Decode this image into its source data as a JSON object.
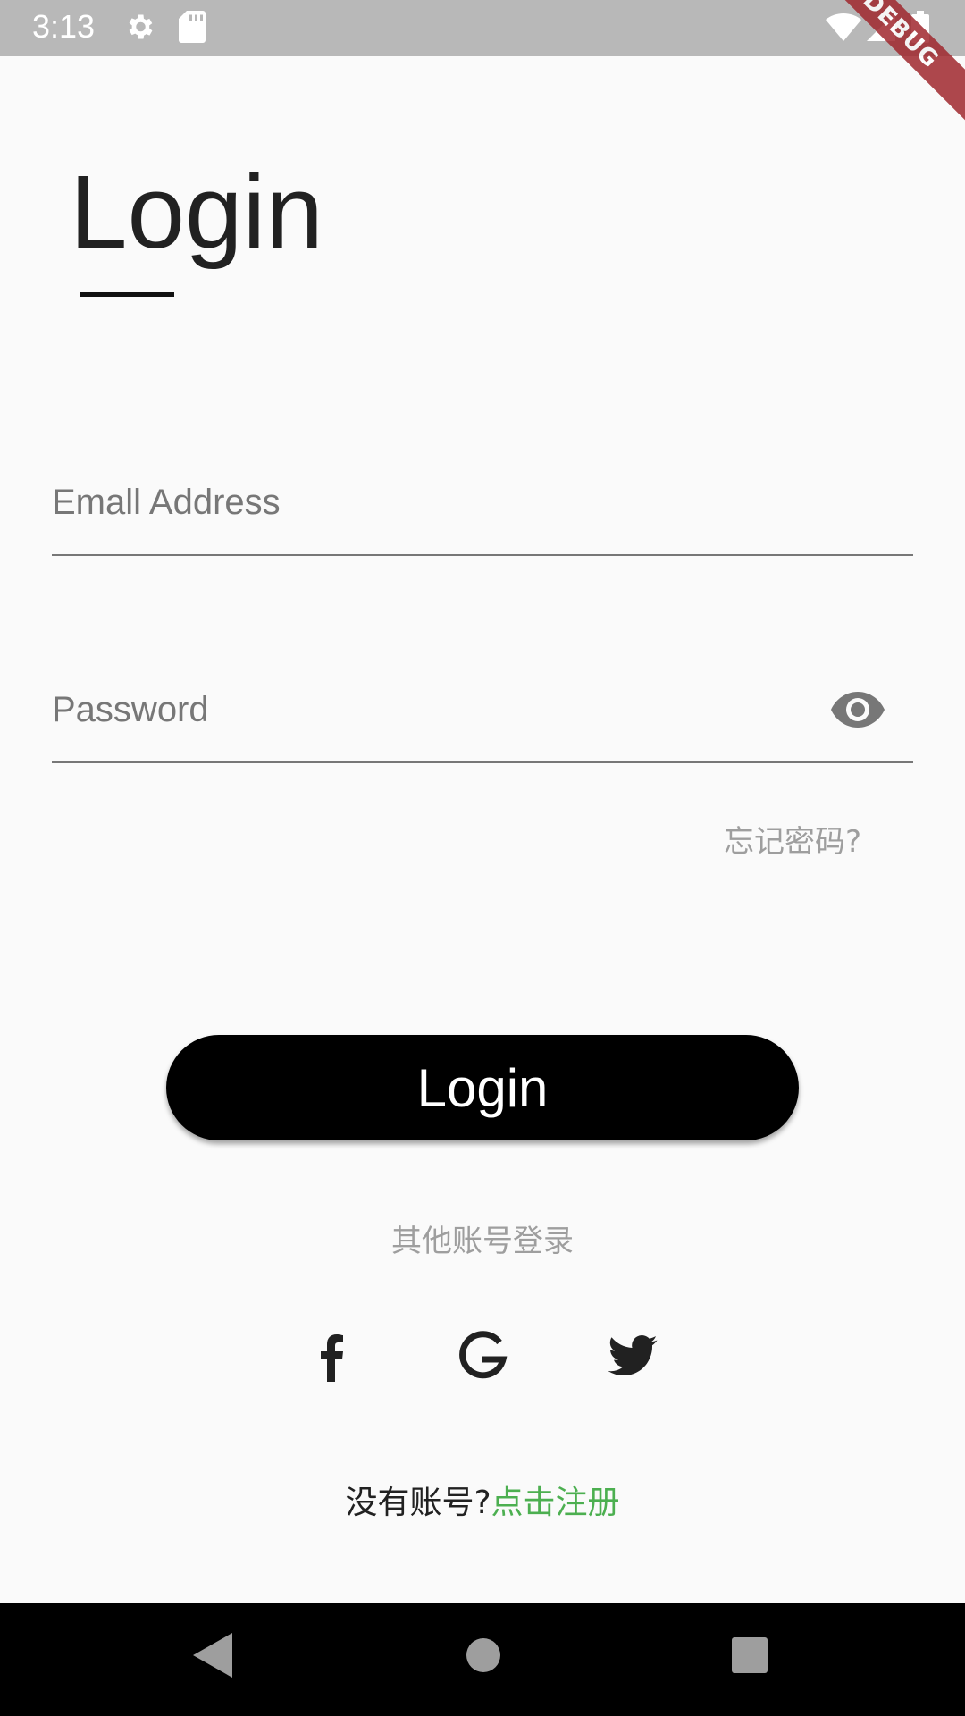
{
  "status_bar": {
    "time": "3:13",
    "icons": [
      "gear-icon",
      "sd-card-icon",
      "wifi-icon",
      "signal-icon",
      "battery-icon"
    ]
  },
  "debug_banner": "DEBUG",
  "title": "Login",
  "email_field": {
    "placeholder": "Emall Address"
  },
  "password_field": {
    "placeholder": "Password",
    "toggle_icon": "eye-icon"
  },
  "forgot_password": "忘记密码?",
  "login_button": "Login",
  "other_login_label": "其他账号登录",
  "social_buttons": [
    "facebook-icon",
    "google-icon",
    "twitter-icon"
  ],
  "signup": {
    "prompt": "没有账号?",
    "link": "点击注册"
  },
  "colors": {
    "accent_link": "#4caf50",
    "button_bg": "#000000",
    "background": "#fafafa"
  },
  "nav_bar": [
    "back-icon",
    "home-icon",
    "recents-icon"
  ]
}
